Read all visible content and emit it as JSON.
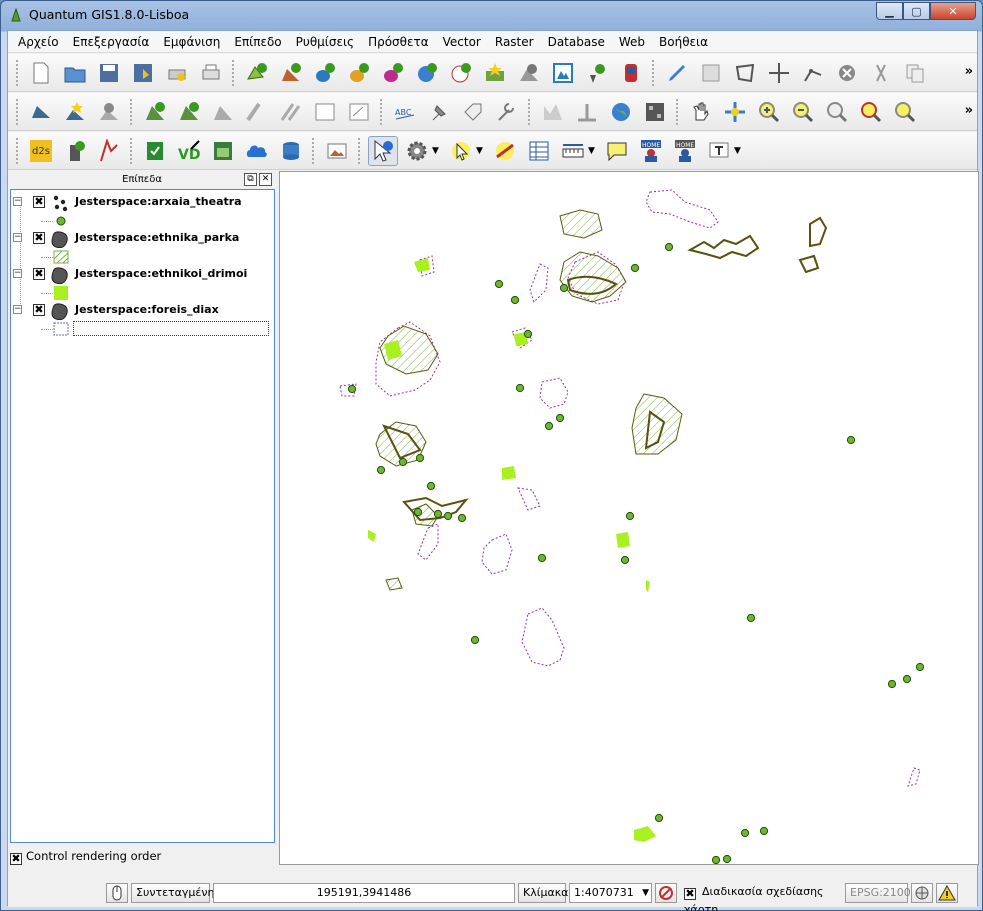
{
  "window": {
    "title": "Quantum GIS1.8.0-Lisboa",
    "min_label": "▁",
    "max_label": "▢",
    "close_label": "✕"
  },
  "menu": [
    "Αρχείο",
    "Επεξεργασία",
    "Εμφάνιση",
    "Επίπεδο",
    "Ρυθμίσεις",
    "Πρόσθετα",
    "Vector",
    "Raster",
    "Database",
    "Web",
    "Βοήθεια"
  ],
  "toolbar": {
    "more": "»",
    "d2s": "d2s",
    "home1": "HOME",
    "home2": "HOME"
  },
  "layers_panel": {
    "title": "Επίπεδα",
    "layers": [
      {
        "name": "Jesterspace:arxaia_theatra"
      },
      {
        "name": "Jesterspace:ethnika_parka"
      },
      {
        "name": "Jesterspace:ethnikoi_drimoi"
      },
      {
        "name": "Jesterspace:foreis_diax"
      }
    ],
    "control_rendering_order": "Control rendering order",
    "checked": "✖"
  },
  "status": {
    "coordinate_label": "Συντεταγμένη:",
    "coordinate_value": "195191,3941486",
    "scale_label": "Κλίμακα",
    "scale_value": "1:4070731",
    "render_label": "Διαδικασία σχεδίασης χάρτη",
    "epsg": "EPSG:2100"
  },
  "colors": {
    "point_fill": "#6ab82e",
    "point_stroke": "#2a4a10",
    "forest_fill": "#a8f020",
    "park_line": "#5a5a10",
    "boundary_dash": "#9b2bb0",
    "hatch": "#7ab040"
  }
}
